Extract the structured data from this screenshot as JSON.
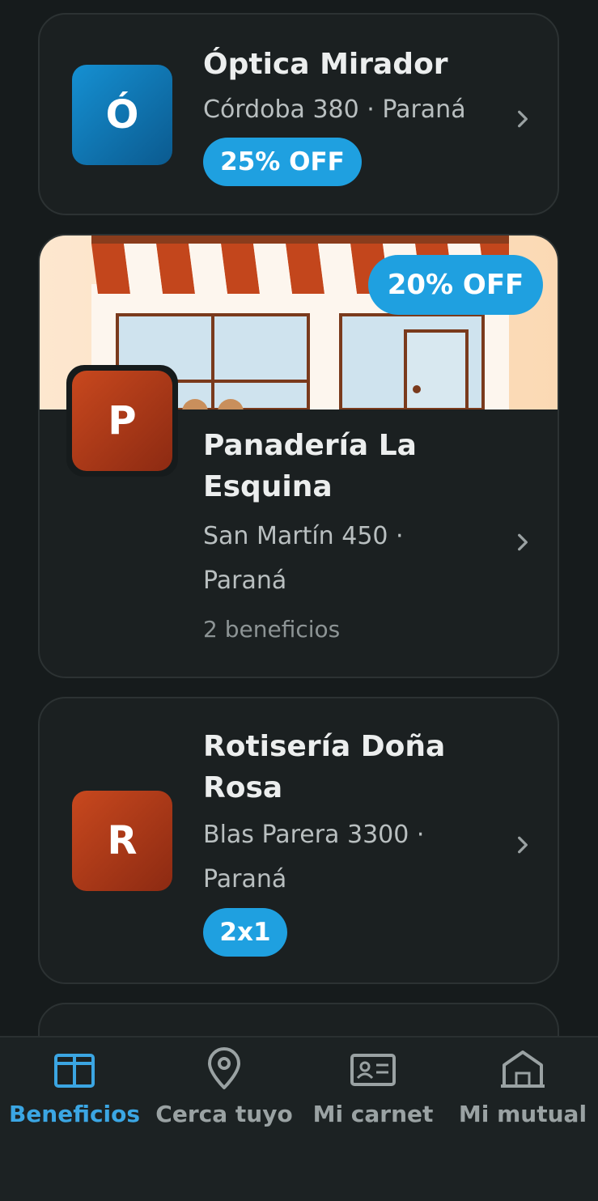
{
  "cards": [
    {
      "logo_letter": "Ó",
      "name": "Óptica Mirador",
      "address": "Córdoba 380 · Paraná",
      "badge": "25% OFF"
    },
    {
      "logo_letter": "P",
      "name_line1": "Panadería La",
      "name_line2": "Esquina",
      "address_line1": "San Martín 450 ·",
      "address_line2": "Paraná",
      "benefits": "2 beneficios",
      "badge": "20% OFF"
    },
    {
      "logo_letter": "R",
      "name_line1": "Rotisería Doña",
      "name_line2": "Rosa",
      "address_line1": "Blas Parera 3300 ·",
      "address_line2": "Paraná",
      "badge": "2x1"
    }
  ],
  "nav": {
    "items": [
      {
        "label": "Beneficios",
        "icon": "gift-icon",
        "active": true
      },
      {
        "label": "Cerca tuyo",
        "icon": "location-pin-icon",
        "active": false
      },
      {
        "label": "Mi carnet",
        "icon": "id-card-icon",
        "active": false
      },
      {
        "label": "Mi mutual",
        "icon": "building-icon",
        "active": false
      }
    ]
  },
  "colors": {
    "background": "#161b1c",
    "card": "#1b2021",
    "accent": "#1fa0e0",
    "active_nav": "#3ba6e3"
  }
}
